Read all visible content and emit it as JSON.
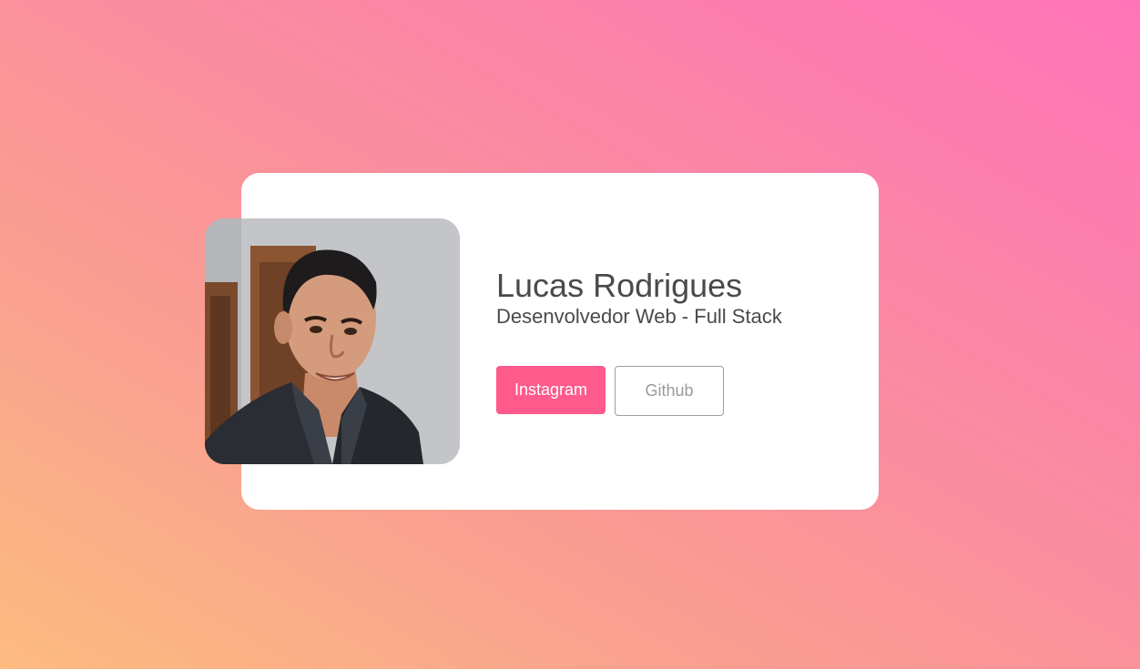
{
  "profile": {
    "name": "Lucas Rodrigues",
    "role": "Desenvolvedor Web - Full Stack"
  },
  "buttons": {
    "instagram_label": "Instagram",
    "github_label": "Github"
  },
  "colors": {
    "accent": "#ff5a8c",
    "text": "#4a4a4a",
    "card": "#ffffff"
  }
}
